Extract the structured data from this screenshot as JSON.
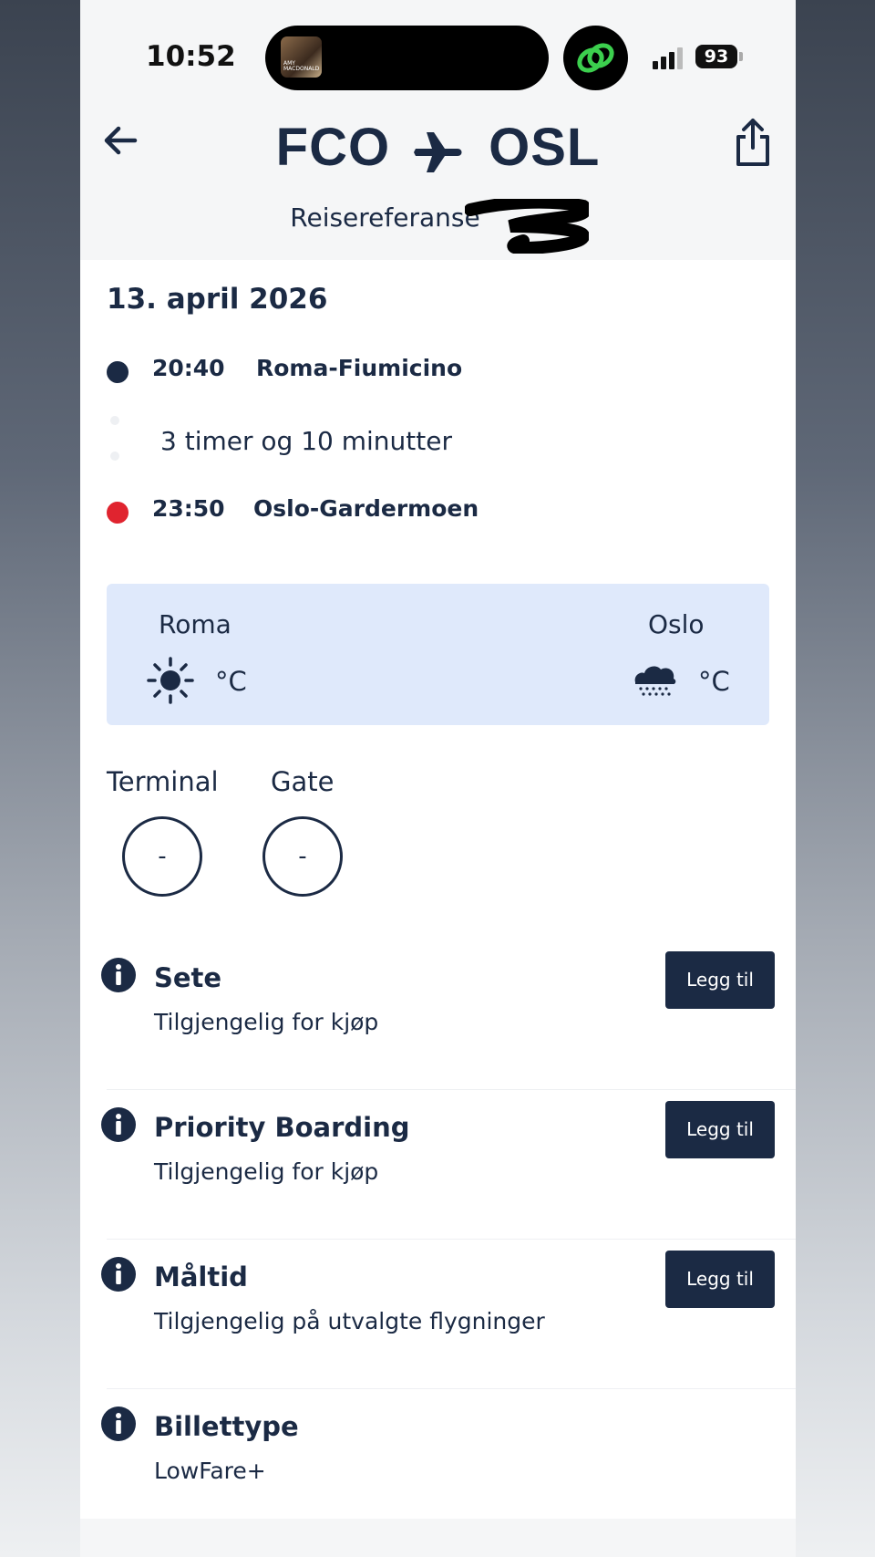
{
  "status_bar": {
    "time": "10:52",
    "battery": "93",
    "album_art_text": "AMY MACDONALD",
    "icons": [
      "music-now-playing-icon",
      "green-app-icon",
      "signal-icon",
      "battery-icon"
    ]
  },
  "header": {
    "origin": "FCO",
    "destination": "OSL",
    "reference_label": "Reisereferanse",
    "icons": [
      "back-arrow-icon",
      "plane-icon",
      "share-icon"
    ]
  },
  "flight": {
    "date": "13. april 2026",
    "departure": {
      "time": "20:40",
      "airport": "Roma-Fiumicino",
      "dot_color": "#1b2a44"
    },
    "duration": "3 timer og 10 minutter",
    "arrival": {
      "time": "23:50",
      "airport": "Oslo-Gardermoen",
      "dot_color": "#e0242f"
    }
  },
  "weather": {
    "origin": {
      "city": "Roma",
      "temp_unit": "°C",
      "icon": "sun-icon"
    },
    "destination": {
      "city": "Oslo",
      "temp_unit": "°C",
      "icon": "rain-cloud-icon"
    }
  },
  "gate_info": {
    "terminal_label": "Terminal",
    "terminal_value": "-",
    "gate_label": "Gate",
    "gate_value": "-"
  },
  "extras": [
    {
      "title": "Sete",
      "subtitle": "Tilgjengelig for kjøp",
      "button": "Legg til"
    },
    {
      "title": "Priority Boarding",
      "subtitle": "Tilgjengelig for kjøp",
      "button": "Legg til"
    },
    {
      "title": "Måltid",
      "subtitle": "Tilgjengelig på utvalgte flygninger",
      "button": "Legg til"
    },
    {
      "title": "Billettype",
      "subtitle": "LowFare+"
    }
  ],
  "colors": {
    "navy": "#1b2a44",
    "red": "#e0242f",
    "weather_bg": "#dfe9fb"
  }
}
